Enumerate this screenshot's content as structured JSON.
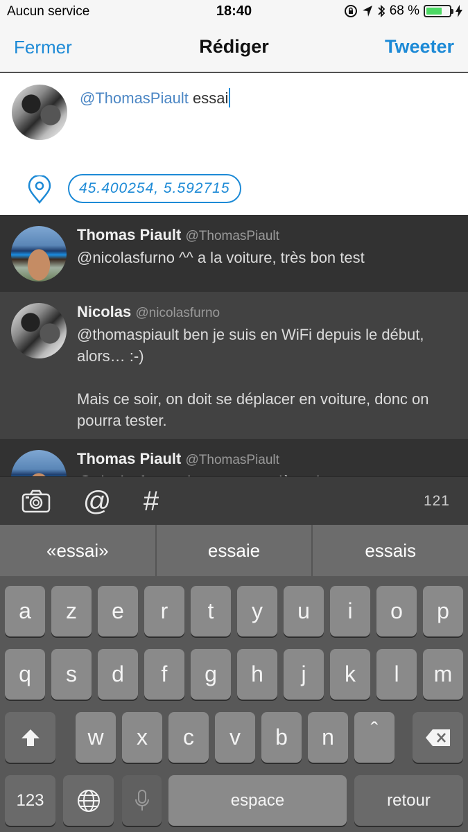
{
  "status_bar": {
    "carrier": "Aucun service",
    "time": "18:40",
    "battery": "68 %",
    "battery_level": 0.68
  },
  "nav": {
    "close_label": "Fermer",
    "title": "Rédiger",
    "send_label": "Tweeter"
  },
  "compose": {
    "mention": "@ThomasPiault",
    "text": "essai",
    "location": "45.400254, 5.592715"
  },
  "tweets": [
    {
      "name": "Thomas Piault",
      "handle": "@ThomasPiault",
      "text": "@nicolasfurno ^^ a la voiture, très bon test"
    },
    {
      "name": "Nicolas",
      "handle": "@nicolasfurno",
      "text": "@thomaspiault ben je suis en WiFi depuis le début, alors… :-)\n\nMais ce soir, on doit se déplacer en voiture, donc on pourra tester."
    },
    {
      "name": "Thomas Piault",
      "handle": "@ThomasPiault",
      "text": "@nicolasfurno alors ces premières heures avec"
    }
  ],
  "toolbar": {
    "char_count": "121"
  },
  "suggestions": [
    "«essai»",
    "essaie",
    "essais"
  ],
  "keyboard": {
    "row1": [
      "a",
      "z",
      "e",
      "r",
      "t",
      "y",
      "u",
      "i",
      "o",
      "p"
    ],
    "row2": [
      "q",
      "s",
      "d",
      "f",
      "g",
      "h",
      "j",
      "k",
      "l",
      "m"
    ],
    "row3": [
      "w",
      "x",
      "c",
      "v",
      "b",
      "n",
      "ˆ"
    ],
    "numbers_label": "123",
    "space_label": "espace",
    "return_label": "retour"
  }
}
